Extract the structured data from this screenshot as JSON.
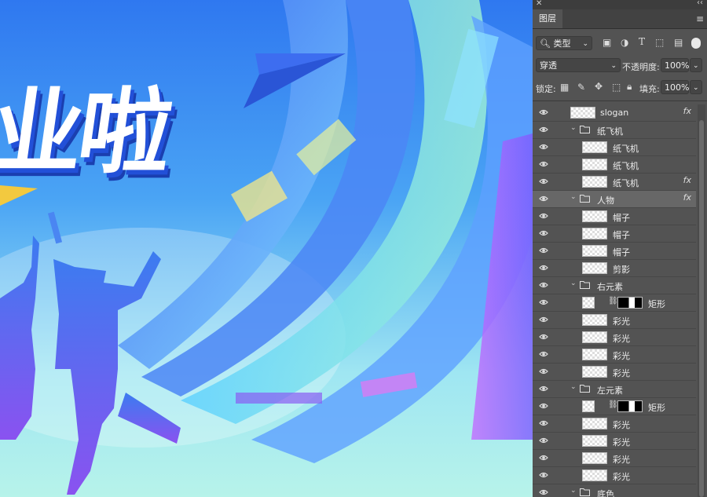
{
  "canvas": {
    "slogan_text": "业啦"
  },
  "panel": {
    "title": "图层",
    "filter_type": "类型",
    "blend_mode": "穿透",
    "opacity_label": "不透明度:",
    "opacity_value": "100%",
    "lock_label": "锁定:",
    "fill_label": "填充:",
    "fill_value": "100%",
    "layers": [
      {
        "name": "slogan",
        "kind": "layer",
        "fx": true
      },
      {
        "name": "纸飞机",
        "kind": "group",
        "fx": false
      },
      {
        "name": "纸飞机",
        "kind": "layer",
        "fx": false
      },
      {
        "name": "纸飞机",
        "kind": "layer",
        "fx": false
      },
      {
        "name": "纸飞机",
        "kind": "layer",
        "fx": true
      },
      {
        "name": "人物",
        "kind": "group",
        "fx": true
      },
      {
        "name": "帽子",
        "kind": "layer",
        "fx": false
      },
      {
        "name": "帽子",
        "kind": "layer",
        "fx": false
      },
      {
        "name": "帽子",
        "kind": "layer",
        "fx": false
      },
      {
        "name": "剪影",
        "kind": "layer",
        "fx": false
      },
      {
        "name": "右元素",
        "kind": "group",
        "fx": false
      },
      {
        "name": "矩形",
        "kind": "masked",
        "fx": false
      },
      {
        "name": "彩光",
        "kind": "layer",
        "fx": false
      },
      {
        "name": "彩光",
        "kind": "layer",
        "fx": false
      },
      {
        "name": "彩光",
        "kind": "layer",
        "fx": false
      },
      {
        "name": "彩光",
        "kind": "layer",
        "fx": false
      },
      {
        "name": "左元素",
        "kind": "group",
        "fx": false
      },
      {
        "name": "矩形",
        "kind": "masked",
        "fx": false
      },
      {
        "name": "彩光",
        "kind": "layer",
        "fx": false
      },
      {
        "name": "彩光",
        "kind": "layer",
        "fx": false
      },
      {
        "name": "彩光",
        "kind": "layer",
        "fx": false
      },
      {
        "name": "彩光",
        "kind": "layer",
        "fx": false
      },
      {
        "name": "底色",
        "kind": "group",
        "fx": false
      }
    ]
  }
}
